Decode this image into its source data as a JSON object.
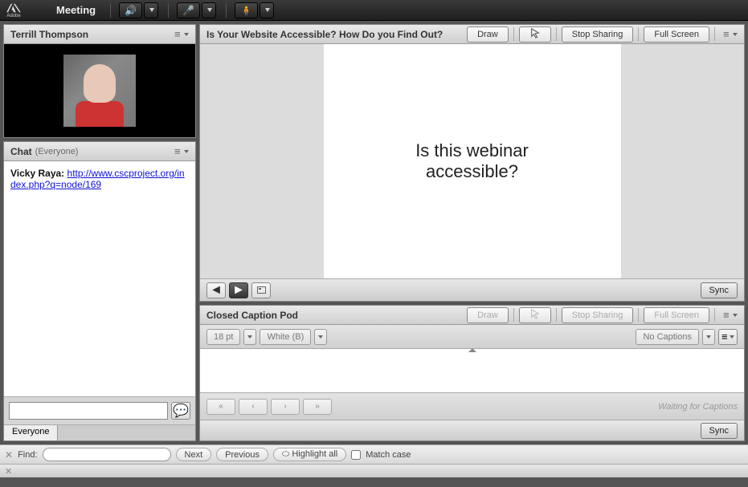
{
  "menu": {
    "meeting": "Meeting"
  },
  "brand": "Adobe",
  "presenter": {
    "name": "Terrill Thompson"
  },
  "chat": {
    "title": "Chat",
    "scope": "(Everyone)",
    "sender": "Vicky Raya:",
    "link": "http://www.cscproject.org/index.php?q=node/169",
    "tab": "Everyone"
  },
  "share": {
    "title": "Is Your Website Accessible? How Do you Find Out?",
    "draw": "Draw",
    "stop": "Stop Sharing",
    "full": "Full Screen",
    "slide_line1": "Is this webinar",
    "slide_line2": "accessible?",
    "sync": "Sync"
  },
  "caption": {
    "title": "Closed Caption Pod",
    "draw": "Draw",
    "stop": "Stop Sharing",
    "full": "Full Screen",
    "font": "18 pt",
    "color": "White (B)",
    "nocap": "No Captions",
    "waiting": "Waiting for Captions",
    "sync": "Sync"
  },
  "find": {
    "label": "Find:",
    "next": "Next",
    "prev": "Previous",
    "highlight": "Highlight all",
    "match": "Match case"
  }
}
